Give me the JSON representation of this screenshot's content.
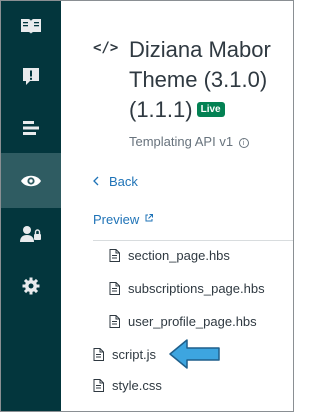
{
  "sidebar": {
    "items": [
      {
        "name": "guide-icon",
        "active": false
      },
      {
        "name": "alert-icon",
        "active": false
      },
      {
        "name": "list-icon",
        "active": false
      },
      {
        "name": "eye-icon",
        "active": true
      },
      {
        "name": "user-lock-icon",
        "active": false
      },
      {
        "name": "gear-icon",
        "active": false
      }
    ]
  },
  "header": {
    "code_icon": "</>",
    "title_line1": "Diziana Mabor",
    "title_line2": "Theme (3.1.0)",
    "title_line3": "(1.1.1)",
    "badge": "Live",
    "subtitle": "Templating API v1",
    "subtitle_icon": "i"
  },
  "nav": {
    "back_label": "Back",
    "preview_label": "Preview"
  },
  "files": [
    {
      "name": "section_page.hbs"
    },
    {
      "name": "subscriptions_page.hbs"
    },
    {
      "name": "user_profile_page.hbs"
    },
    {
      "name": "script.js"
    },
    {
      "name": "style.css"
    }
  ],
  "colors": {
    "sidebar_bg": "#03363d",
    "sidebar_active": "#2f5c62",
    "link": "#1f73b7",
    "badge_bg": "#038153",
    "arrow": "#3da5e0"
  }
}
